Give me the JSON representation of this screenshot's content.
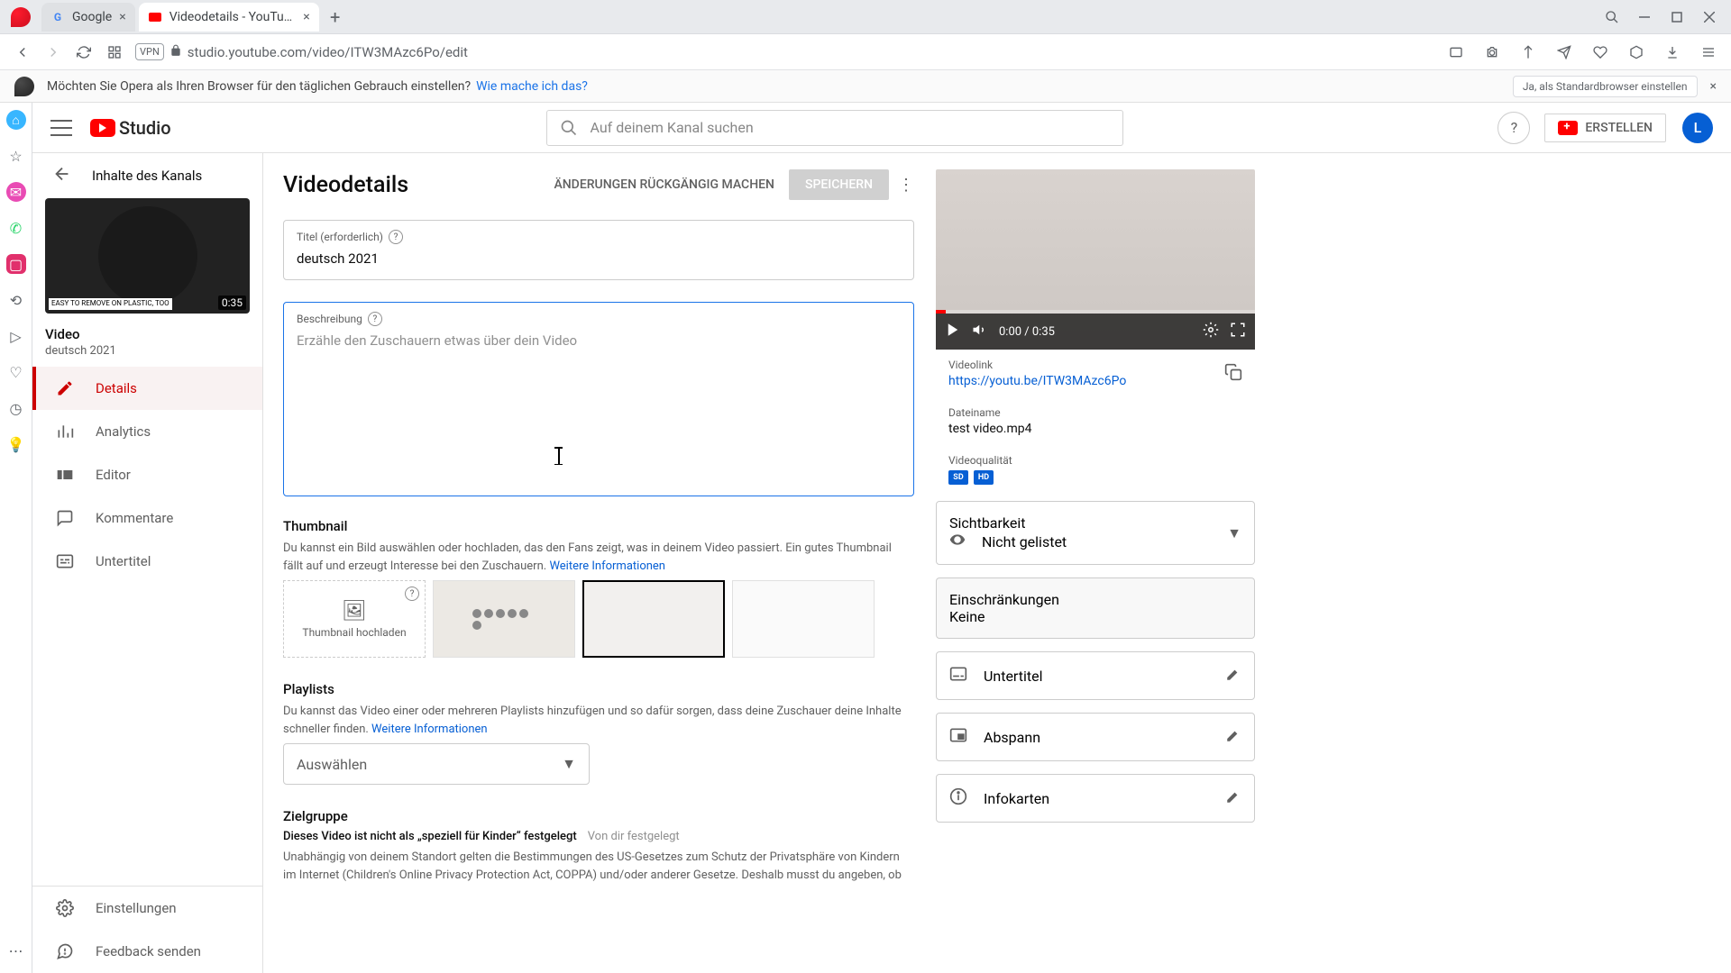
{
  "os": {
    "tabs": [
      {
        "title": "Google",
        "active": false
      },
      {
        "title": "Videodetails - YouTube St...",
        "active": true
      }
    ],
    "url": "studio.youtube.com/video/ITW3MAzc6Po/edit",
    "vpn": "VPN"
  },
  "promo": {
    "text": "Möchten Sie Opera als Ihren Browser für den täglichen Gebrauch einstellen?",
    "link": "Wie mache ich das?",
    "button": "Ja, als Standardbrowser einstellen"
  },
  "header": {
    "logo": "Studio",
    "search_placeholder": "Auf deinem Kanal suchen",
    "create": "ERSTELLEN",
    "avatar": "L"
  },
  "sidebar": {
    "back_label": "Inhalte des Kanals",
    "thumb_duration": "0:35",
    "thumb_badge": "EASY TO REMOVE ON PLASTIC, TOO",
    "video_heading": "Video",
    "video_title": "deutsch 2021",
    "items": [
      {
        "label": "Details",
        "active": true
      },
      {
        "label": "Analytics",
        "active": false
      },
      {
        "label": "Editor",
        "active": false
      },
      {
        "label": "Kommentare",
        "active": false
      },
      {
        "label": "Untertitel",
        "active": false
      }
    ],
    "bottom": [
      {
        "label": "Einstellungen"
      },
      {
        "label": "Feedback senden"
      }
    ]
  },
  "main": {
    "title": "Videodetails",
    "undo": "ÄNDERUNGEN RÜCKGÄNGIG MACHEN",
    "save": "SPEICHERN",
    "fields": {
      "title_label": "Titel (erforderlich)",
      "title_value": "deutsch 2021",
      "desc_label": "Beschreibung",
      "desc_placeholder": "Erzähle den Zuschauern etwas über dein Video"
    },
    "thumbnail": {
      "title": "Thumbnail",
      "desc": "Du kannst ein Bild auswählen oder hochladen, das den Fans zeigt, was in deinem Video passiert. Ein gutes Thumbnail fällt auf und erzeugt Interesse bei den Zuschauern.",
      "more_info": "Weitere Informationen",
      "upload": "Thumbnail hochladen"
    },
    "playlists": {
      "title": "Playlists",
      "desc": "Du kannst das Video einer oder mehreren Playlists hinzufügen und so dafür sorgen, dass deine Zuschauer deine Inhalte schneller finden.",
      "more_info": "Weitere Informationen",
      "select": "Auswählen"
    },
    "audience": {
      "title": "Zielgruppe",
      "sub": "Dieses Video ist nicht als „speziell für Kinder“ festgelegt",
      "set_by": "Von dir festgelegt",
      "desc": "Unabhängig von deinem Standort gelten die Bestimmungen des US-Gesetzes zum Schutz der Privatsphäre von Kindern im Internet (Children's Online Privacy Protection Act, COPPA) und/oder anderer Gesetze. Deshalb musst du angeben, ob"
    }
  },
  "right": {
    "time": "0:00 / 0:35",
    "videolink_label": "Videolink",
    "videolink": "https://youtu.be/ITW3MAzc6Po",
    "filename_label": "Dateiname",
    "filename": "test video.mp4",
    "quality_label": "Videoqualität",
    "quality_badges": [
      "SD",
      "HD"
    ],
    "visibility_label": "Sichtbarkeit",
    "visibility_value": "Nicht gelistet",
    "restrictions_label": "Einschränkungen",
    "restrictions_value": "Keine",
    "cards": [
      {
        "label": "Untertitel"
      },
      {
        "label": "Abspann"
      },
      {
        "label": "Infokarten"
      }
    ]
  }
}
